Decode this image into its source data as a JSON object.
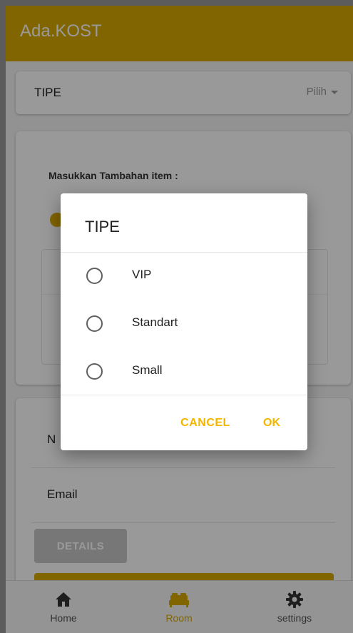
{
  "app": {
    "title": "Ada.KOST",
    "accent_color": "#d8a800",
    "dialog_button_color": "#f2b600"
  },
  "tipe_field": {
    "label": "TIPE",
    "select_placeholder": "Pilih"
  },
  "items_section": {
    "heading": "Masukkan Tambahan item :"
  },
  "form": {
    "name_label": "N",
    "email_label": "Email",
    "details_label": "DETAILS"
  },
  "tabs": [
    {
      "label": "Home",
      "icon": "home-icon",
      "active": false
    },
    {
      "label": "Room",
      "icon": "bed-icon",
      "active": true
    },
    {
      "label": "settings",
      "icon": "gear-icon",
      "active": false
    }
  ],
  "dialog": {
    "title": "TIPE",
    "options": [
      {
        "label": "VIP",
        "selected": false
      },
      {
        "label": "Standart",
        "selected": false
      },
      {
        "label": "Small",
        "selected": false
      }
    ],
    "cancel_label": "CANCEL",
    "ok_label": "OK"
  }
}
